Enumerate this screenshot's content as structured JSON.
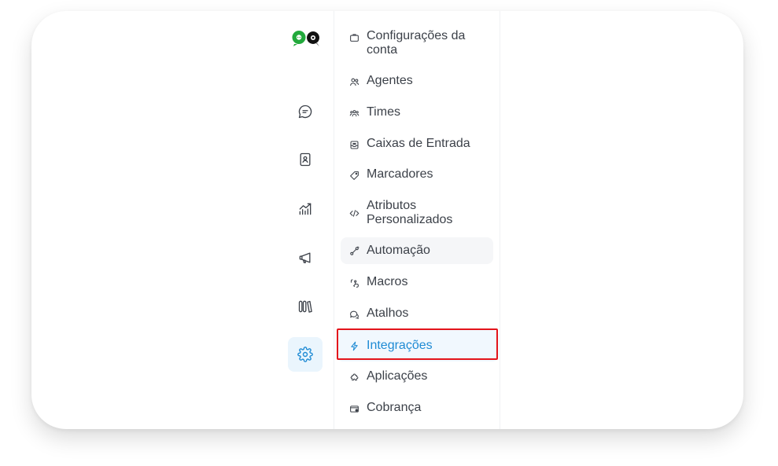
{
  "sidebar": {
    "rail": [
      {
        "icon": "chat-bubble-icon",
        "active": false
      },
      {
        "icon": "contacts-book-icon",
        "active": false
      },
      {
        "icon": "reports-chart-icon",
        "active": false
      },
      {
        "icon": "campaigns-megaphone-icon",
        "active": false
      },
      {
        "icon": "library-books-icon",
        "active": false
      },
      {
        "icon": "settings-gear-icon",
        "active": true
      }
    ]
  },
  "menu": {
    "items": [
      {
        "label": "Configurações da conta",
        "icon": "briefcase-icon"
      },
      {
        "label": "Agentes",
        "icon": "people-icon"
      },
      {
        "label": "Times",
        "icon": "team-icon"
      },
      {
        "label": "Caixas de Entrada",
        "icon": "inbox-icon"
      },
      {
        "label": "Marcadores",
        "icon": "tag-icon"
      },
      {
        "label": "Atributos Personalizados",
        "icon": "code-icon"
      },
      {
        "label": "Automação",
        "icon": "automation-icon"
      },
      {
        "label": "Macros",
        "icon": "macro-icon"
      },
      {
        "label": "Atalhos",
        "icon": "speech-icon"
      },
      {
        "label": "Integrações",
        "icon": "lightning-icon"
      },
      {
        "label": "Aplicações",
        "icon": "puzzle-icon"
      },
      {
        "label": "Cobrança",
        "icon": "wallet-icon"
      }
    ],
    "hovered": "Automação",
    "active": "Integrações"
  },
  "colors": {
    "accent": "#1f8bd4",
    "highlight_box": "#e3141b",
    "text": "#3c4149",
    "logo_green": "#22a93c",
    "logo_black": "#111111"
  }
}
